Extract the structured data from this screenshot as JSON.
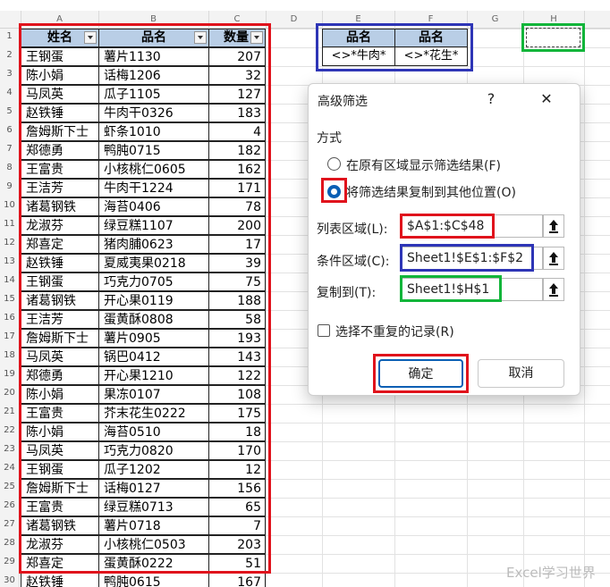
{
  "columns": [
    "A",
    "B",
    "C",
    "D",
    "E",
    "F",
    "G",
    "H"
  ],
  "table": {
    "headers": [
      "姓名",
      "品名",
      "数量"
    ],
    "rows": [
      [
        "王钢蛋",
        "薯片1130",
        "207"
      ],
      [
        "陈小娟",
        "话梅1206",
        "32"
      ],
      [
        "马凤英",
        "瓜子1105",
        "127"
      ],
      [
        "赵铁锤",
        "牛肉干0326",
        "183"
      ],
      [
        "詹姆斯下士",
        "虾条1010",
        "4"
      ],
      [
        "郑德勇",
        "鸭肫0715",
        "182"
      ],
      [
        "王富贵",
        "小核桃仁0605",
        "162"
      ],
      [
        "王洁芳",
        "牛肉干1224",
        "171"
      ],
      [
        "诸葛钢铁",
        "海苔0406",
        "78"
      ],
      [
        "龙淑芬",
        "绿豆糕1107",
        "200"
      ],
      [
        "郑喜定",
        "猪肉脯0623",
        "17"
      ],
      [
        "赵铁锤",
        "夏威夷果0218",
        "39"
      ],
      [
        "王钢蛋",
        "巧克力0705",
        "75"
      ],
      [
        "诸葛钢铁",
        "开心果0119",
        "188"
      ],
      [
        "王洁芳",
        "蛋黄酥0808",
        "58"
      ],
      [
        "詹姆斯下士",
        "薯片0905",
        "193"
      ],
      [
        "马凤英",
        "锅巴0412",
        "143"
      ],
      [
        "郑德勇",
        "开心果1210",
        "122"
      ],
      [
        "陈小娟",
        "果冻0107",
        "108"
      ],
      [
        "王富贵",
        "芥末花生0222",
        "175"
      ],
      [
        "陈小娟",
        "海苔0510",
        "18"
      ],
      [
        "马凤英",
        "巧克力0820",
        "170"
      ],
      [
        "王钢蛋",
        "瓜子1202",
        "12"
      ],
      [
        "詹姆斯下士",
        "话梅0127",
        "156"
      ],
      [
        "王富贵",
        "绿豆糕0713",
        "65"
      ],
      [
        "诸葛钢铁",
        "薯片0718",
        "7"
      ],
      [
        "龙淑芬",
        "小核桃仁0503",
        "203"
      ],
      [
        "郑喜定",
        "蛋黄酥0222",
        "51"
      ],
      [
        "赵铁锤",
        "鸭肫0615",
        "167"
      ]
    ]
  },
  "criteria": {
    "headers": [
      "品名",
      "品名"
    ],
    "values": [
      "<>*牛肉*",
      "<>*花生*"
    ]
  },
  "dialog": {
    "title": "高级筛选",
    "help": "?",
    "close": "✕",
    "method_label": "方式",
    "option1": "在原有区域显示筛选结果(F)",
    "option2": "将筛选结果复制到其他位置(O)",
    "list_range_label": "列表区域(L):",
    "list_range_value": "$A$1:$C$48",
    "criteria_range_label": "条件区域(C):",
    "criteria_range_value": "Sheet1!$E$1:$F$2",
    "copy_to_label": "复制到(T):",
    "copy_to_value": "Sheet1!$H$1",
    "unique_label": "选择不重复的记录(R)",
    "ok": "确定",
    "cancel": "取消"
  },
  "watermark": "Excel学习世界",
  "colors": {
    "red": "#e0131c",
    "blue": "#2e35b6",
    "green": "#12b53a",
    "header_fill": "#b9cee6",
    "accent": "#0a5fb4"
  }
}
